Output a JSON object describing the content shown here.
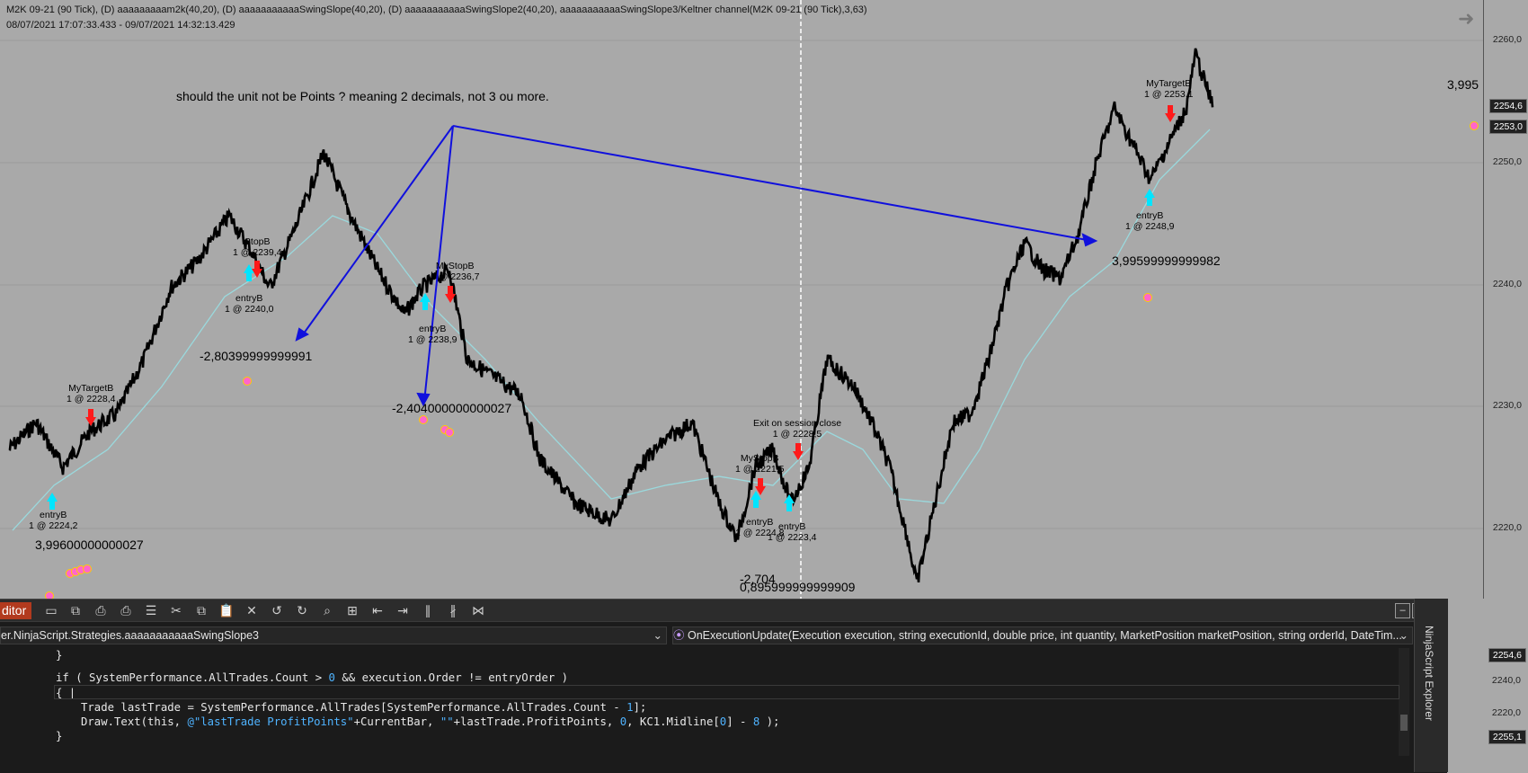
{
  "chart": {
    "header_line1": "M2K 09-21 (90 Tick), (D) aaaaaaaaam2k(40,20), (D) aaaaaaaaaaaSwingSlope(40,20), (D) aaaaaaaaaaaSwingSlope2(40,20), aaaaaaaaaaaSwingSlope3/Keltner channel(M2K 09-21 (90 Tick),3,63)",
    "header_line2": "08/07/2021 17:07:33.433 - 09/07/2021 14:32:13.429",
    "note": "should the unit not be Points ? meaning 2 decimals, not 3 ou more.",
    "pnl_values": [
      "3,99600000000027",
      "-2,80399999999991",
      "-2,404000000000027",
      "-2,704",
      "0,895999999999909",
      "3,99599999999982"
    ],
    "big_value": "3,995",
    "trade_labels": [
      {
        "line1": "MyTargetB",
        "line2": "1 @ 2228,4"
      },
      {
        "line1": "entryB",
        "line2": "1 @ 2224,2"
      },
      {
        "line1": "StopB",
        "line2": "1 @ 2239,4"
      },
      {
        "line1": "entryB",
        "line2": "1 @ 2240,0"
      },
      {
        "line1": "MyStopB",
        "line2": "1 @ 2236,7"
      },
      {
        "line1": "entryB",
        "line2": "1 @ 2238,9"
      },
      {
        "line1": "Exit on session close",
        "line2": "1 @ 2228,5"
      },
      {
        "line1": "MyStopB",
        "line2": "1 @ 2221,5"
      },
      {
        "line1": "entryB",
        "line2": "1 @ 2224,8"
      },
      {
        "line1": "entryB",
        "line2": "1 @ 2223,4"
      },
      {
        "line1": "MyTargetB",
        "line2": "1 @ 2253,1"
      },
      {
        "line1": "entryB",
        "line2": "1 @ 2248,9"
      }
    ],
    "y_ticks": [
      "2260,0",
      "2250,0",
      "2240,0",
      "2230,0",
      "2220,0"
    ],
    "price_tags": [
      "2254,6",
      "2253,0"
    ],
    "lower_ticks": [
      "2240,0",
      "2220,0"
    ],
    "lower_tags": [
      "2254,6",
      "2255,1"
    ],
    "colors": {
      "background": "#a9a9a9",
      "price": "#000000",
      "keltner": "#9ad9dd",
      "annotation_arrow": "#1010dd",
      "up_arrow": "#00e5ff",
      "down_arrow": "#ff1a1a"
    }
  },
  "editor": {
    "title": "ditor",
    "namespace_combo": "er.NinjaScript.Strategies.aaaaaaaaaaaSwingSlope3",
    "method_combo": "OnExecutionUpdate(Execution execution, string executionId, double price, int quantity, MarketPosition marketPosition, string orderId, DateTim...",
    "side_panel": "NinjaScript Explorer",
    "code": {
      "l1": "}",
      "l2a": "if ( SystemPerformance.AllTrades.Count > ",
      "l2b": "0",
      "l2c": " && execution.Order != entryOrder )",
      "l3": "{ |",
      "l4a": "Trade lastTrade = SystemPerformance.AllTrades[SystemPerformance.AllTrades.Count - ",
      "l4b": "1",
      "l4c": "];",
      "l5a": "Draw.Text(this, ",
      "l5b": "@\"lastTrade ProfitPoints\"",
      "l5c": "+CurrentBar, ",
      "l5d": "\"\"",
      "l5e": "+lastTrade.ProfitPoints, ",
      "l5f": "0",
      "l5g": ", KC1.Midline[",
      "l5h": "0",
      "l5i": "] - ",
      "l5j": "8",
      "l5k": " );",
      "l6": "}"
    }
  }
}
